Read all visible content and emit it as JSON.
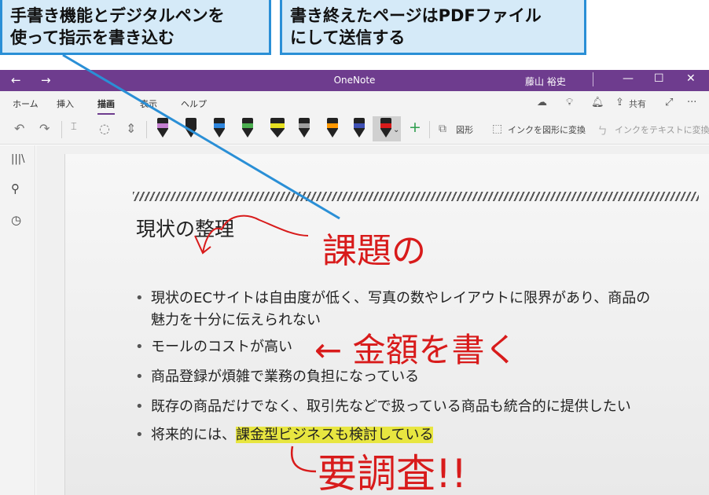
{
  "callouts": [
    {
      "line1": "手書き機能とデジタルペンを",
      "line2": "使って指示を書き込む"
    },
    {
      "line1": "書き終えたページはPDFファイル",
      "line2": "にして送信する"
    }
  ],
  "titlebar": {
    "back": "←",
    "forward": "→",
    "app": "OneNote",
    "user": "藤山 裕史",
    "minimize": "—",
    "maximize": "☐",
    "close": "✕"
  },
  "tabs": [
    "ホーム",
    "挿入",
    "描画",
    "表示",
    "ヘルプ"
  ],
  "active_tab": "描画",
  "ribbon_right": {
    "share": "共有",
    "more": "···"
  },
  "toolbar": {
    "shapes": "図形",
    "ink_to_shape": "インクを図形に変換",
    "ink_to_text": "インクをテキストに変換",
    "pens": [
      {
        "color": "#c47fd0"
      },
      {
        "color": "#222222"
      },
      {
        "color": "#2e86de"
      },
      {
        "color": "#4caf50"
      },
      {
        "color": "#e6e021"
      },
      {
        "color": "#9e9e9e"
      },
      {
        "color": "#ff9800"
      },
      {
        "color": "#3f51b5"
      },
      {
        "color": "#d81b1b"
      }
    ]
  },
  "page": {
    "title": "現状の整理",
    "bullets": [
      {
        "text": "現状のECサイトは自由度が低く、写真の数やレイアウトに限界があり、商品の",
        "cont": "魅力を十分に伝えられない"
      },
      {
        "text": "モールのコストが高い"
      },
      {
        "text": "商品登録が煩雑で業務の負担になっている"
      },
      {
        "text": "既存の商品だけでなく、取引先などで扱っている商品も統合的に提供したい"
      },
      {
        "text_plain": "将来的には、",
        "text_highlight": "課金型ビジネスも検討している"
      }
    ]
  },
  "ink": {
    "note1": "課題の",
    "note2": "← 金額を書く",
    "note3": "要調査!!"
  },
  "colors": {
    "accent": "#6e3c8e",
    "ink": "#d81b1b",
    "callout_border": "#2a8fd6",
    "callout_fill": "#d5eaf8",
    "highlight": "#e8e640"
  }
}
